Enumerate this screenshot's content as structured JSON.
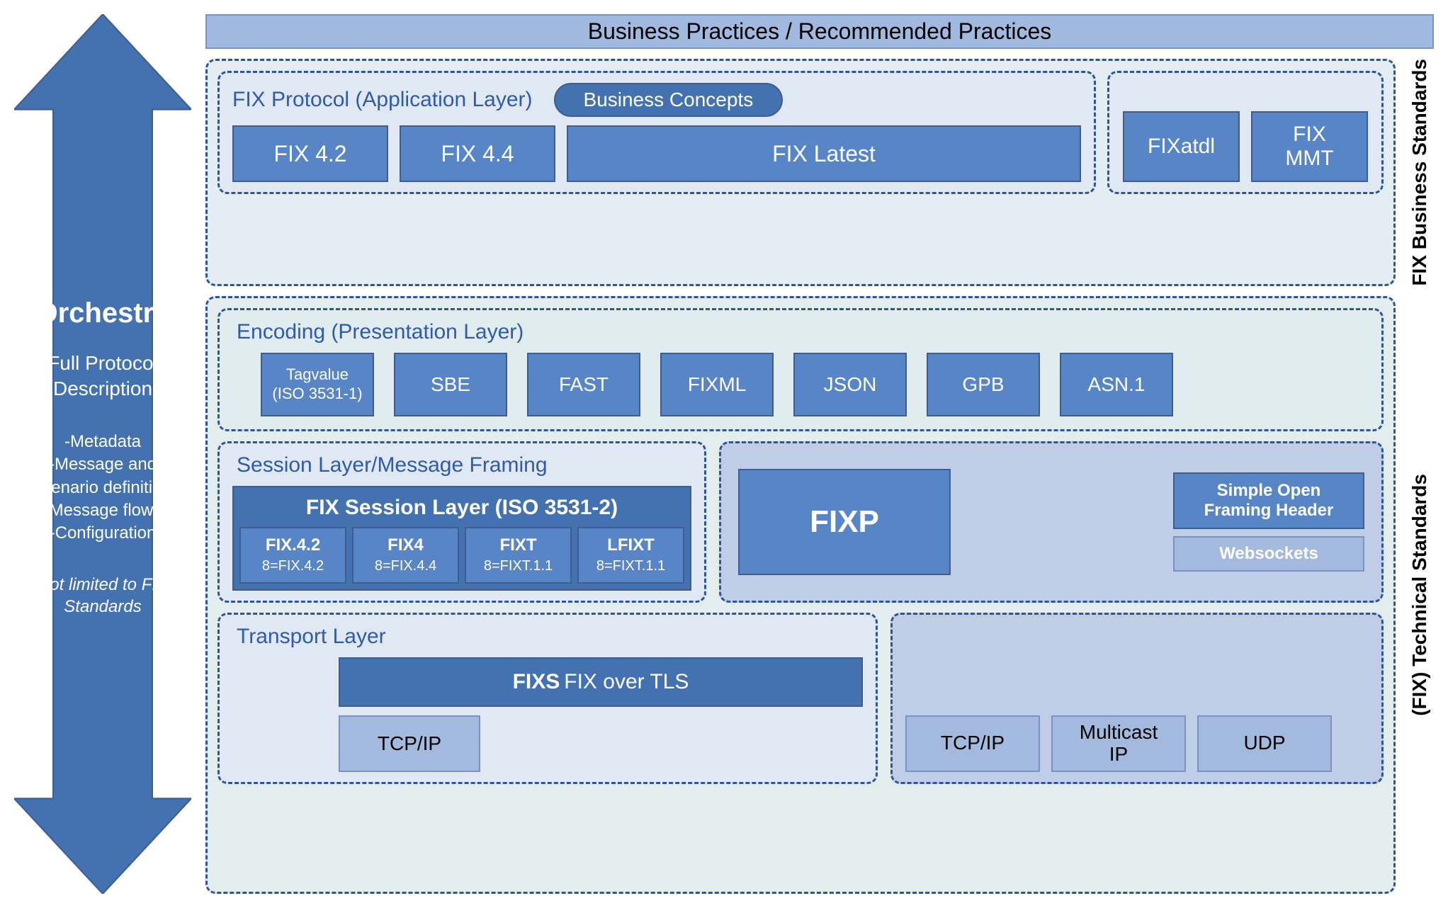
{
  "orchestra": {
    "title": "Orchestra",
    "tagline": "Full Protocol Description",
    "bullets": [
      "-Metadata",
      "-Message and scenario definition",
      "-Message flows",
      "-Configuration"
    ],
    "footnote": "Not limited to FIX Standards"
  },
  "top_band": "Business Practices / Recommended Practices",
  "side_labels": {
    "business": "FIX Business Standards",
    "technical": "(FIX) Technical Standards"
  },
  "app_layer": {
    "title": "FIX Protocol (Application Layer)",
    "pill": "Business Concepts",
    "fix42": "FIX 4.2",
    "fix44": "FIX 4.4",
    "fixlatest": "FIX Latest",
    "fixatdl": "FIXatdl",
    "fixmmt_l1": "FIX",
    "fixmmt_l2": "MMT"
  },
  "encoding": {
    "title": "Encoding (Presentation Layer)",
    "tagvalue_l1": "Tagvalue",
    "tagvalue_l2": "(ISO 3531-1)",
    "sbe": "SBE",
    "fast": "FAST",
    "fixml": "FIXML",
    "json": "JSON",
    "gpb": "GPB",
    "asn1": "ASN.1"
  },
  "session": {
    "title": "Session Layer/Message Framing",
    "group_title": "FIX Session Layer (ISO 3531-2)",
    "fix42_t": "FIX.4.2",
    "fix42_s": "8=FIX.4.2",
    "fix4_t": "FIX4",
    "fix4_s": "8=FIX.4.4",
    "fixt_t": "FIXT",
    "fixt_s": "8=FIXT.1.1",
    "lfixt_t": "LFIXT",
    "lfixt_s": "8=FIXT.1.1",
    "fixp": "FIXP",
    "sofh_l1": "Simple Open",
    "sofh_l2": "Framing Header",
    "websockets": "Websockets"
  },
  "transport": {
    "title": "Transport Layer",
    "fixs_bold": "FIXS",
    "fixs_rest": "FIX over TLS",
    "tcpip_left": "TCP/IP",
    "tcpip_right": "TCP/IP",
    "multicast_l1": "Multicast",
    "multicast_l2": "IP",
    "udp": "UDP"
  }
}
